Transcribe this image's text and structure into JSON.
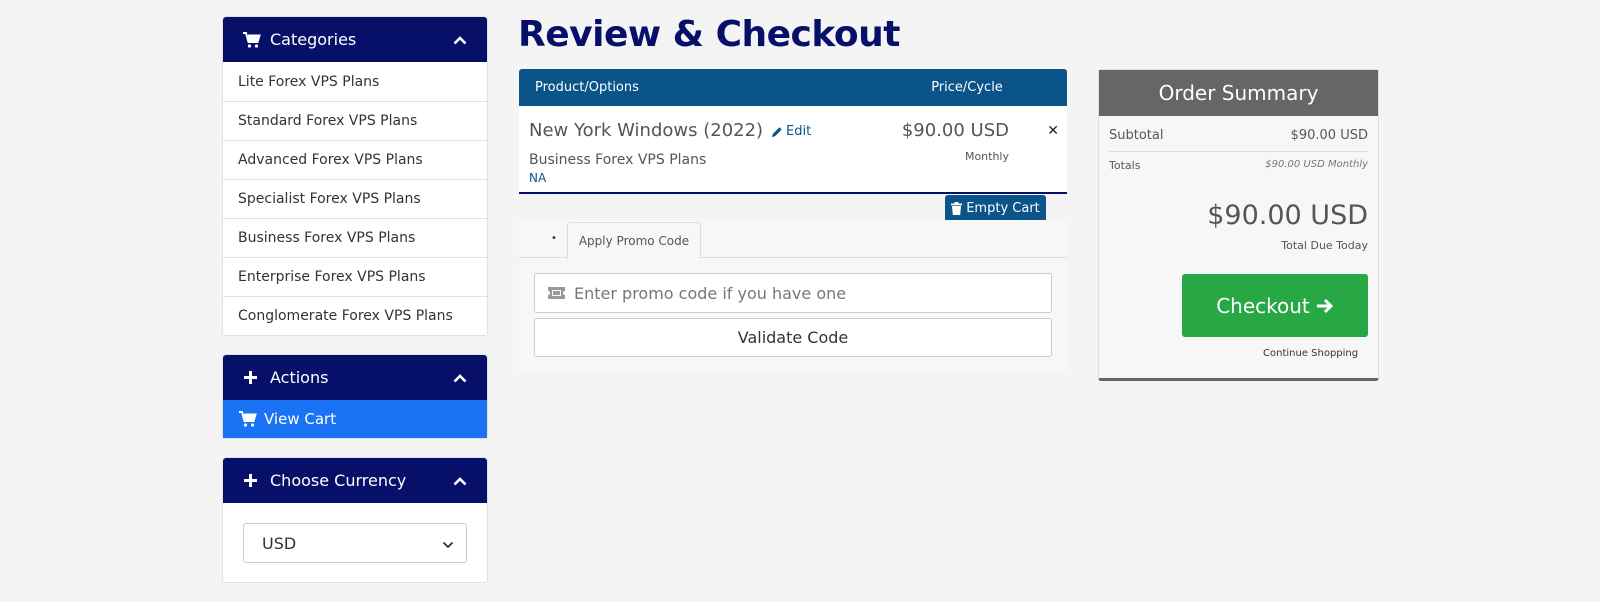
{
  "sidebar": {
    "categories": {
      "title": "Categories",
      "items": [
        {
          "label": "Lite Forex VPS Plans"
        },
        {
          "label": "Standard Forex VPS Plans"
        },
        {
          "label": "Advanced Forex VPS Plans"
        },
        {
          "label": "Specialist Forex VPS Plans"
        },
        {
          "label": "Business Forex VPS Plans"
        },
        {
          "label": "Enterprise Forex VPS Plans"
        },
        {
          "label": "Conglomerate Forex VPS Plans"
        }
      ]
    },
    "actions": {
      "title": "Actions",
      "view_cart_label": "View Cart"
    },
    "currency": {
      "title": "Choose Currency",
      "selected": "USD"
    }
  },
  "main": {
    "title": "Review & Checkout",
    "cart": {
      "header_product": "Product/Options",
      "header_price": "Price/Cycle",
      "item": {
        "name": "New York Windows (2022)",
        "edit_label": "Edit",
        "group": "Business Forex VPS Plans",
        "domain": "NA",
        "price": "$90.00 USD",
        "cycle": "Monthly",
        "remove_glyph": "✕"
      },
      "empty_cart_label": "Empty Cart"
    },
    "promo": {
      "bullet": "•",
      "tab_label": "Apply Promo Code",
      "placeholder": "Enter promo code if you have one",
      "validate_label": "Validate Code"
    }
  },
  "summary": {
    "title": "Order Summary",
    "subtotal_label": "Subtotal",
    "subtotal_value": "$90.00 USD",
    "totals_label": "Totals",
    "totals_value": "$90.00 USD Monthly",
    "total_due": "$90.00 USD",
    "total_due_label": "Total Due Today",
    "checkout_label": "Checkout",
    "continue_label": "Continue Shopping"
  },
  "colors": {
    "navy": "#071069",
    "primary": "#0b5489",
    "view_cart": "#1a73f5",
    "checkout": "#28a745",
    "summary_header": "#666666"
  }
}
